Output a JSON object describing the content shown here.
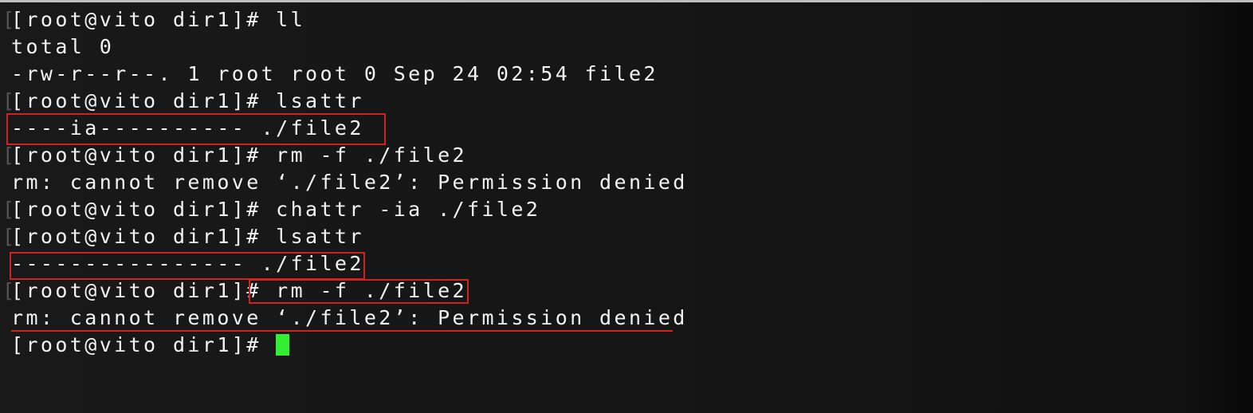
{
  "terminal": {
    "prompt": "[root@vito dir1]#",
    "lines": [
      {
        "prompt": "[root@vito dir1]#",
        "command": " ll"
      },
      {
        "text": "total 0"
      },
      {
        "text": "-rw-r--r--. 1 root root 0 Sep 24 02:54 file2"
      },
      {
        "prompt": "[root@vito dir1]#",
        "command": " lsattr"
      },
      {
        "text": "----ia---------- ./file2"
      },
      {
        "prompt": "[root@vito dir1]#",
        "command": " rm -f ./file2"
      },
      {
        "text": "rm: cannot remove ‘./file2’: Permission denied"
      },
      {
        "prompt": "[root@vito dir1]#",
        "command": " chattr -ia ./file2"
      },
      {
        "prompt": "[root@vito dir1]#",
        "command": " lsattr"
      },
      {
        "text": "---------------- ./file2"
      },
      {
        "prompt": "[root@vito dir1]#",
        "command": " rm -f ./file2"
      },
      {
        "text": "rm: cannot remove ‘./file2’: Permission denied"
      },
      {
        "prompt": "[root@vito dir1]#",
        "command": " "
      }
    ]
  },
  "colors": {
    "background": "#161616",
    "text": "#f2f2f2",
    "cursor": "#33ee33",
    "annotation": "#d0231f"
  }
}
